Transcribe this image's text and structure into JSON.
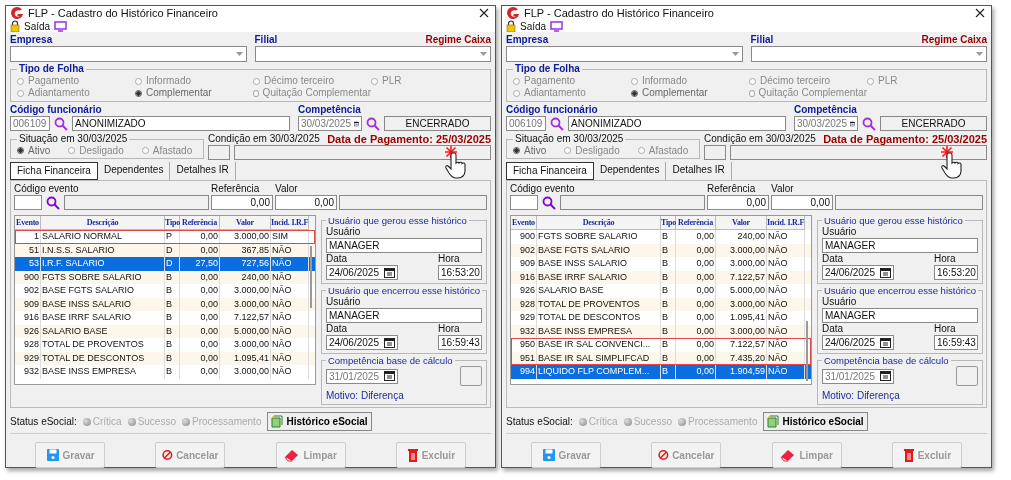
{
  "windows": [
    {
      "title": "FLP - Cadastro do Histórico Financeiro",
      "exit_label": "Saída",
      "empresa_label": "Empresa",
      "filial_label": "Filial",
      "regime": "Regime Caixa",
      "tipo_folha": {
        "title": "Tipo de Folha",
        "options": [
          {
            "label": "Pagamento",
            "selected": false
          },
          {
            "label": "Informado",
            "selected": false
          },
          {
            "label": "Décimo terceiro",
            "selected": false
          },
          {
            "label": "PLR",
            "selected": false
          },
          {
            "label": "Adiantamento",
            "selected": false
          },
          {
            "label": "Complementar",
            "selected": true
          },
          {
            "label": "Quitação Complementar",
            "selected": false
          }
        ]
      },
      "funcionario": {
        "label": "Código funcionário",
        "code": "006109",
        "name": "ANONIMIZADO"
      },
      "competencia": {
        "label": "Competência",
        "date": "30/03/2025",
        "status": "ENCERRADO"
      },
      "situacao": {
        "title": "Situação em  30/03/2025",
        "options": [
          {
            "label": "Ativo",
            "selected": true
          },
          {
            "label": "Desligado",
            "selected": false
          },
          {
            "label": "Afastado",
            "selected": false
          }
        ]
      },
      "condicao_label": "Condição em 30/03/2025",
      "data_pagamento": "Data de Pagamento: 25/03/2025",
      "tabs": [
        {
          "label": "Ficha Financeira",
          "selected": true
        },
        {
          "label": "Dependentes",
          "selected": false
        },
        {
          "label": "Detalhes IR",
          "selected": false
        }
      ],
      "evento": {
        "label": "Código evento",
        "referencia_label": "Referência",
        "valor_label": "Valor",
        "referencia": "0,00",
        "valor": "0,00"
      },
      "grid": {
        "columns": [
          "Evento",
          "Descrição",
          "Tipo",
          "Referência",
          "Valor",
          "Incid. I.R.F"
        ],
        "rows": [
          {
            "evento": "1",
            "descricao": "SALARIO NORMAL",
            "tipo": "P",
            "referencia": "0,00",
            "valor": "3.000,00",
            "incid": "SIM",
            "selected": false,
            "highlighted": true
          },
          {
            "evento": "51",
            "descricao": "I.N.S.S. SALARIO",
            "tipo": "D",
            "referencia": "0,00",
            "valor": "367,85",
            "incid": "NÃO",
            "selected": false,
            "highlighted": false
          },
          {
            "evento": "53",
            "descricao": "I.R.F. SALARIO",
            "tipo": "D",
            "referencia": "27,50",
            "valor": "727,56",
            "incid": "NÃO",
            "selected": true,
            "highlighted": false
          },
          {
            "evento": "900",
            "descricao": "FGTS SOBRE SALARIO",
            "tipo": "B",
            "referencia": "0,00",
            "valor": "240,00",
            "incid": "NÃO",
            "selected": false,
            "highlighted": false
          },
          {
            "evento": "902",
            "descricao": "BASE FGTS SALARIO",
            "tipo": "B",
            "referencia": "0,00",
            "valor": "3.000,00",
            "incid": "NÃO",
            "selected": false,
            "highlighted": false
          },
          {
            "evento": "909",
            "descricao": "BASE INSS SALARIO",
            "tipo": "B",
            "referencia": "0,00",
            "valor": "3.000,00",
            "incid": "NÃO",
            "selected": false,
            "highlighted": false
          },
          {
            "evento": "916",
            "descricao": "BASE IRRF SALARIO",
            "tipo": "B",
            "referencia": "0,00",
            "valor": "7.122,57",
            "incid": "NÃO",
            "selected": false,
            "highlighted": false
          },
          {
            "evento": "926",
            "descricao": "SALARIO BASE",
            "tipo": "B",
            "referencia": "0,00",
            "valor": "5.000,00",
            "incid": "NÃO",
            "selected": false,
            "highlighted": false
          },
          {
            "evento": "928",
            "descricao": "TOTAL DE PROVENTOS",
            "tipo": "B",
            "referencia": "0,00",
            "valor": "3.000,00",
            "incid": "NÃO",
            "selected": false,
            "highlighted": false
          },
          {
            "evento": "929",
            "descricao": "TOTAL DE DESCONTOS",
            "tipo": "B",
            "referencia": "0,00",
            "valor": "1.095,41",
            "incid": "NÃO",
            "selected": false,
            "highlighted": false
          },
          {
            "evento": "932",
            "descricao": "BASE INSS EMPRESA",
            "tipo": "B",
            "referencia": "0,00",
            "valor": "3.000,00",
            "incid": "NÃO",
            "selected": false,
            "highlighted": false
          }
        ]
      },
      "gerou": {
        "title": "Usuário que gerou esse histórico",
        "usuario_label": "Usuário",
        "usuario": "MANAGER",
        "data_label": "Data",
        "data": "24/06/2025",
        "hora_label": "Hora",
        "hora": "16:53:20"
      },
      "encerrou": {
        "title": "Usuário que encerrou esse histórico",
        "usuario_label": "Usuário",
        "usuario": "MANAGER",
        "data_label": "Data",
        "data": "24/06/2025",
        "hora_label": "Hora",
        "hora": "16:59:43"
      },
      "competencia_base": {
        "title": "Competência base de cálculo",
        "date": "31/01/2025"
      },
      "motivo": "Motivo: Diferença",
      "esocial": {
        "label": "Status eSocial:",
        "options": [
          "Crítica",
          "Sucesso",
          "Processamento"
        ],
        "button": "Histórico eSocial"
      },
      "buttons": [
        {
          "label": "Gravar",
          "kind": "save"
        },
        {
          "label": "Cancelar",
          "kind": "cancel"
        },
        {
          "label": "Limpar",
          "kind": "clear"
        },
        {
          "label": "Excluir",
          "kind": "delete"
        }
      ]
    },
    {
      "title": "FLP - Cadastro do Histórico Financeiro",
      "exit_label": "Saída",
      "empresa_label": "Empresa",
      "filial_label": "Filial",
      "regime": "Regime Caixa",
      "tipo_folha": {
        "title": "Tipo de Folha",
        "options": [
          {
            "label": "Pagamento",
            "selected": false
          },
          {
            "label": "Informado",
            "selected": false
          },
          {
            "label": "Décimo terceiro",
            "selected": false
          },
          {
            "label": "PLR",
            "selected": false
          },
          {
            "label": "Adiantamento",
            "selected": false
          },
          {
            "label": "Complementar",
            "selected": true
          },
          {
            "label": "Quitação Complementar",
            "selected": false
          }
        ]
      },
      "funcionario": {
        "label": "Código funcionário",
        "code": "006109",
        "name": "ANONIMIZADO"
      },
      "competencia": {
        "label": "Competência",
        "date": "30/03/2025",
        "status": "ENCERRADO"
      },
      "situacao": {
        "title": "Situação em  30/03/2025",
        "options": [
          {
            "label": "Ativo",
            "selected": true
          },
          {
            "label": "Desligado",
            "selected": false
          },
          {
            "label": "Afastado",
            "selected": false
          }
        ]
      },
      "condicao_label": "Condição em 30/03/2025",
      "data_pagamento": "Data de Pagamento: 25/03/2025",
      "tabs": [
        {
          "label": "Ficha Financeira",
          "selected": true
        },
        {
          "label": "Dependentes",
          "selected": false
        },
        {
          "label": "Detalhes IR",
          "selected": false
        }
      ],
      "evento": {
        "label": "Código evento",
        "referencia_label": "Referência",
        "valor_label": "Valor",
        "referencia": "0,00",
        "valor": "0,00"
      },
      "grid": {
        "columns": [
          "Evento",
          "Descrição",
          "Tipo",
          "Referência",
          "Valor",
          "Incid. I.R.F"
        ],
        "rows": [
          {
            "evento": "900",
            "descricao": "FGTS SOBRE SALARIO",
            "tipo": "B",
            "referencia": "0,00",
            "valor": "240,00",
            "incid": "NÃO",
            "selected": false,
            "highlighted": false
          },
          {
            "evento": "902",
            "descricao": "BASE FGTS SALARIO",
            "tipo": "B",
            "referencia": "0,00",
            "valor": "3.000,00",
            "incid": "NÃO",
            "selected": false,
            "highlighted": false
          },
          {
            "evento": "909",
            "descricao": "BASE INSS SALARIO",
            "tipo": "B",
            "referencia": "0,00",
            "valor": "3.000,00",
            "incid": "NÃO",
            "selected": false,
            "highlighted": false
          },
          {
            "evento": "916",
            "descricao": "BASE IRRF SALARIO",
            "tipo": "B",
            "referencia": "0,00",
            "valor": "7.122,57",
            "incid": "NÃO",
            "selected": false,
            "highlighted": false
          },
          {
            "evento": "926",
            "descricao": "SALARIO BASE",
            "tipo": "B",
            "referencia": "0,00",
            "valor": "5.000,00",
            "incid": "NÃO",
            "selected": false,
            "highlighted": false
          },
          {
            "evento": "928",
            "descricao": "TOTAL DE PROVENTOS",
            "tipo": "B",
            "referencia": "0,00",
            "valor": "3.000,00",
            "incid": "NÃO",
            "selected": false,
            "highlighted": false
          },
          {
            "evento": "929",
            "descricao": "TOTAL DE DESCONTOS",
            "tipo": "B",
            "referencia": "0,00",
            "valor": "1.095,41",
            "incid": "NÃO",
            "selected": false,
            "highlighted": false
          },
          {
            "evento": "932",
            "descricao": "BASE INSS EMPRESA",
            "tipo": "B",
            "referencia": "0,00",
            "valor": "3.000,00",
            "incid": "NÃO",
            "selected": false,
            "highlighted": false
          },
          {
            "evento": "950",
            "descricao": "BASE IR SAL CONVENCI...",
            "tipo": "B",
            "referencia": "0,00",
            "valor": "7.122,57",
            "incid": "NÃO",
            "selected": false,
            "highlighted": true
          },
          {
            "evento": "951",
            "descricao": "BASE IR SAL SIMPLIFCAD",
            "tipo": "B",
            "referencia": "0,00",
            "valor": "7.435,20",
            "incid": "NÃO",
            "selected": false,
            "highlighted": true
          },
          {
            "evento": "994",
            "descricao": "LIQUIDO FLP COMPLEM...",
            "tipo": "B",
            "referencia": "0,00",
            "valor": "1.904,59",
            "incid": "NÃO",
            "selected": true,
            "highlighted": false
          }
        ]
      },
      "gerou": {
        "title": "Usuário que gerou esse histórico",
        "usuario_label": "Usuário",
        "usuario": "MANAGER",
        "data_label": "Data",
        "data": "24/06/2025",
        "hora_label": "Hora",
        "hora": "16:53:20"
      },
      "encerrou": {
        "title": "Usuário que encerrou esse histórico",
        "usuario_label": "Usuário",
        "usuario": "MANAGER",
        "data_label": "Data",
        "data": "24/06/2025",
        "hora_label": "Hora",
        "hora": "16:59:43"
      },
      "competencia_base": {
        "title": "Competência base de cálculo",
        "date": "31/01/2025"
      },
      "motivo": "Motivo: Diferença",
      "esocial": {
        "label": "Status eSocial:",
        "options": [
          "Crítica",
          "Sucesso",
          "Processamento"
        ],
        "button": "Histórico eSocial"
      },
      "buttons": [
        {
          "label": "Gravar",
          "kind": "save"
        },
        {
          "label": "Cancelar",
          "kind": "cancel"
        },
        {
          "label": "Limpar",
          "kind": "clear"
        },
        {
          "label": "Excluir",
          "kind": "delete"
        }
      ]
    }
  ]
}
